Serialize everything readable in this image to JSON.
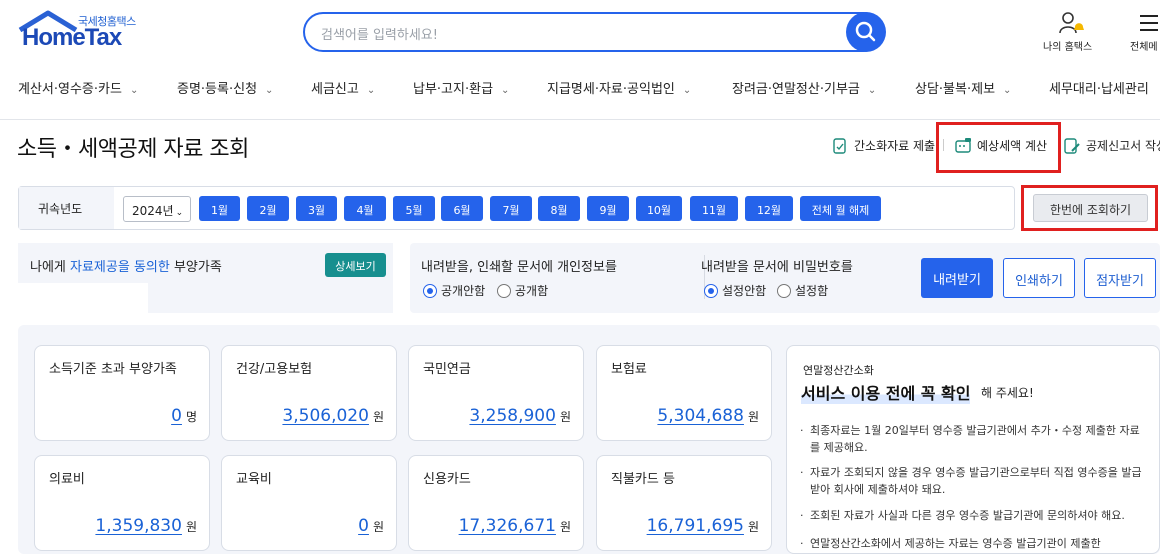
{
  "header": {
    "logo_sub": "국세청홈택스",
    "logo_main": "HomeTax",
    "search_placeholder": "검색어를 입력하세요!",
    "my_hometax": "나의 홈택스",
    "all_menu": "전체메"
  },
  "nav": [
    "계산서·영수증·카드",
    "증명·등록·신청",
    "세금신고",
    "납부·고지·환급",
    "지급명세·자료·공익법인",
    "장려금·연말정산·기부금",
    "상담·불복·제보",
    "세무대리·납세관리"
  ],
  "page_title": "소득・세액공제 자료 조회",
  "quick_links": [
    "간소화자료 제출",
    "예상세액 계산",
    "공제신고서 작성"
  ],
  "year_bar": {
    "label": "귀속년도",
    "selected_year": "2024년",
    "months": [
      "1월",
      "2월",
      "3월",
      "4월",
      "5월",
      "6월",
      "7월",
      "8월",
      "9월",
      "10월",
      "11월",
      "12월"
    ],
    "clear_all": "전체 월 해제",
    "view_all": "한번에 조회하기"
  },
  "consent": {
    "prefix": "나에게 ",
    "highlight": "자료제공을 동의한",
    "suffix": " 부양가족",
    "detail_button": "상세보기"
  },
  "options": {
    "personal_info_title": "내려받을, 인쇄할 문서에 개인정보를",
    "personal_info_options": [
      "공개안함",
      "공개함"
    ],
    "password_title": "내려받을 문서에 비밀번호를",
    "password_options": [
      "설정안함",
      "설정함"
    ],
    "download": "내려받기",
    "print": "인쇄하기",
    "e_receive": "점자받기"
  },
  "cards": [
    {
      "title": "소득기준 초과 부양가족",
      "value": "0",
      "unit": "명"
    },
    {
      "title": "건강/고용보험",
      "value": "3,506,020",
      "unit": "원"
    },
    {
      "title": "국민연금",
      "value": "3,258,900",
      "unit": "원"
    },
    {
      "title": "보험료",
      "value": "5,304,688",
      "unit": "원"
    },
    {
      "title": "의료비",
      "value": "1,359,830",
      "unit": "원"
    },
    {
      "title": "교육비",
      "value": "0",
      "unit": "원"
    },
    {
      "title": "신용카드",
      "value": "17,326,671",
      "unit": "원"
    },
    {
      "title": "직불카드 등",
      "value": "16,791,695",
      "unit": "원"
    }
  ],
  "notice": {
    "sub": "연말정산간소화",
    "title": "서비스 이용 전에 꼭 확인",
    "title_tail": "해 주세요!",
    "items": [
      "최종자료는 1월 20일부터 영수증 발급기관에서 추가・수정 제출한 자료를 제공해요.",
      "자료가 조회되지 않을 경우 영수증 발급기관으로부터 직접 영수증을 발급받아 회사에 제출하셔야 돼요.",
      "조회된 자료가 사실과 다른 경우 영수증 발급기관에 문의하셔야 해요.",
      "연말정산간소화에서 제공하는 자료는 영수증 발급기관이 제출한"
    ]
  },
  "colors": {
    "primary": "#2563eb",
    "highlight_box": "#e0201f",
    "detail_button": "#178f8f"
  }
}
